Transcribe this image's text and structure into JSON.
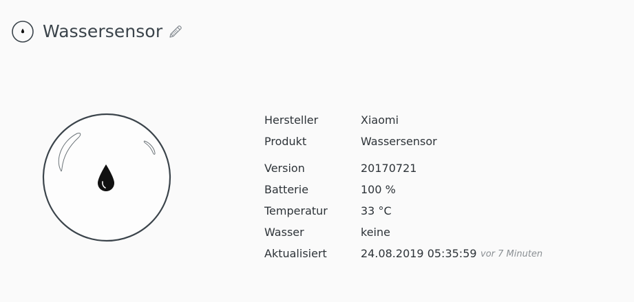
{
  "header": {
    "icon": "water-drop-icon",
    "title": "Wassersensor",
    "edit_icon": "pencil-icon"
  },
  "device": {
    "image": "water-sensor-illustration",
    "accent": "#3b444b"
  },
  "info": {
    "rows": [
      {
        "label": "Hersteller",
        "value": "Xiaomi"
      },
      {
        "label": "Produkt",
        "value": "Wassersensor"
      },
      {
        "label": "Version",
        "value": "20170721"
      },
      {
        "label": "Batterie",
        "value": "100 %"
      },
      {
        "label": "Temperatur",
        "value": "33 °C"
      },
      {
        "label": "Wasser",
        "value": "keine"
      },
      {
        "label": "Aktualisiert",
        "value": "24.08.2019 05:35:59",
        "note": "vor 7 Minuten"
      }
    ]
  }
}
